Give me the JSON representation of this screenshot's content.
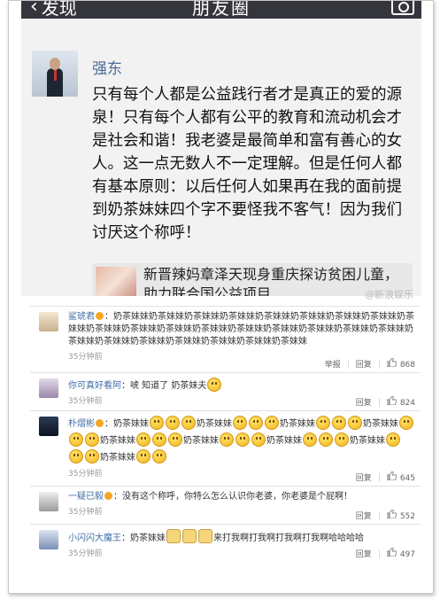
{
  "navbar": {
    "back_label": "发现",
    "title": "朋友圈"
  },
  "post": {
    "author": "强东",
    "text": "只有每个人都是公益践行者才是真正的爱的源泉！只有每个人都有公平的教育和流动机会才是社会和谐！我老婆是最简单和富有善心的女人。这一点无数人不一定理解。但是任何人都有基本原则：以后任何人如果再在我的面前提到奶茶妹妹四个字不要怪我不客气！因为我们讨厌这个称呼！",
    "link_title": "新晋辣妈章泽天现身重庆探访贫困儿童，助力联合国公益项目",
    "watermark": "@新浪娱乐"
  },
  "comments": [
    {
      "name": "鲨琥君",
      "text": "：奶茶妹妹奶茶妹妹奶茶妹妹奶茶妹妹奶茶妹妹奶茶妹妹奶茶妹妹奶茶妹妹奶茶妹妹奶茶妹妹奶茶妹妹奶茶妹妹奶茶妹妹奶茶妹妹奶茶妹妹奶茶妹妹奶茶妹妹奶茶妹妹奶茶妹妹奶茶妹妹奶茶妹妹奶茶妹妹奶茶妹妹奶茶妹妹奶茶妹妹",
      "time": "35分钟前",
      "report": "举报",
      "reply": "回复",
      "likes": "868"
    },
    {
      "name": "你可真好看阿",
      "text": "：唬 知道了 奶茶妹夫",
      "time": "35分钟前",
      "reply": "回复",
      "likes": "824"
    },
    {
      "name": "朴熠彬",
      "text_parts": [
        "：奶茶妹妹",
        "奶茶妹妹",
        "奶茶妹妹",
        "奶茶妹妹",
        "奶茶妹妹",
        "奶茶妹妹",
        "奶茶妹妹",
        "奶茶妹妹",
        "奶茶妹妹"
      ],
      "time": "35分钟前",
      "reply": "回复",
      "likes": "645"
    },
    {
      "name": "一疑已毅",
      "text": "：没有这个称呼，你特么怎么认识你老婆，你老婆是个屁啊！",
      "time": "35分钟前",
      "reply": "回复",
      "likes": "552"
    },
    {
      "name": "小闪闪大魔王",
      "text_a": "：奶茶妹妹",
      "text_b": "来打我啊打我啊打我啊打我啊哈哈哈哈",
      "time": "35分钟前",
      "reply": "回复",
      "likes": "497"
    }
  ],
  "colors": {
    "navbar": "#34363b",
    "name": "#3f6ea6",
    "vip": "#f6a623"
  },
  "icons": [
    "back-chevron-icon",
    "camera-icon",
    "vip-badge-icon",
    "thumb-up-icon",
    "smile-emoji-icon",
    "cat-emoji-icon"
  ]
}
